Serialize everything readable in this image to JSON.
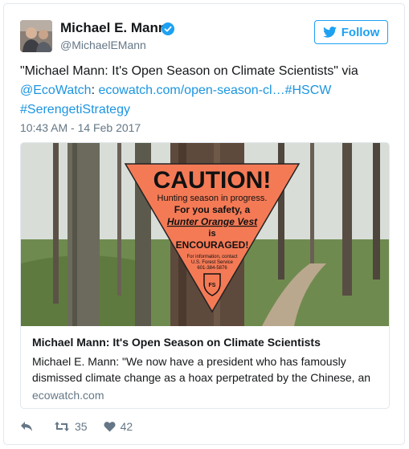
{
  "author": {
    "name": "Michael E. Mann",
    "handle": "@MichaelEMann",
    "verified_icon": "verified-badge-icon"
  },
  "follow_button": {
    "label": "Follow",
    "icon": "twitter-bird-icon"
  },
  "tweet": {
    "text_quote": "\"Michael Mann: It's Open Season on Climate Scientists\" via",
    "mention": "@EcoWatch",
    "colon": ":",
    "url": "ecowatch.com/open-season-cl…",
    "hashtag1": "#HSCW",
    "hashtag2": "#SerengetiStrategy",
    "timestamp": "10:43 AM - 14 Feb 2017"
  },
  "card": {
    "sign": {
      "headline": "CAUTION!",
      "line1": "Hunting season in progress.",
      "line2": "For you  safety, a",
      "line3": "Hunter Orange Vest",
      "line4": "is",
      "line5": "ENCOURAGED!",
      "small1": "For information, contact",
      "small2": "U.S. Forest Service",
      "small3": "601-384-5876"
    },
    "title": "Michael Mann: It's Open Season on Climate Scientists",
    "description": "Michael E. Mann: \"We now have a president who has famously dismissed climate change as a hoax perpetrated by the Chinese, an",
    "domain": "ecowatch.com"
  },
  "actions": {
    "reply_icon": "reply-icon",
    "retweet_icon": "retweet-icon",
    "retweet_count": "35",
    "like_icon": "heart-icon",
    "like_count": "42"
  },
  "colors": {
    "link": "#1b95e0",
    "follow": "#1da1f2",
    "secondary_text": "#657786",
    "sign_orange": "#f47a56"
  }
}
